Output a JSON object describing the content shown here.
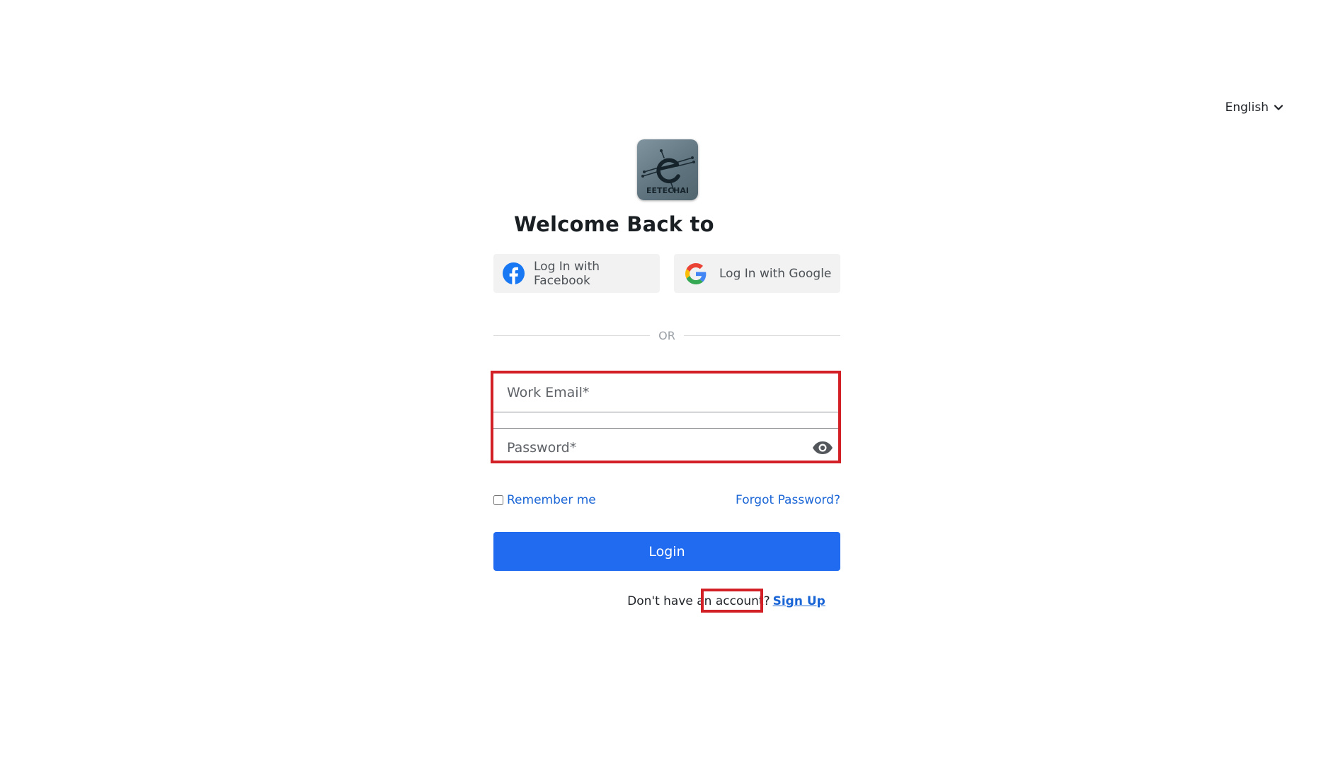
{
  "language": {
    "selected": "English",
    "icon": "chevron-down-icon"
  },
  "logo": {
    "text": "EETECHAI"
  },
  "heading": "Welcome Back to",
  "social": {
    "facebook_label": "Log In with Facebook",
    "google_label": "Log In with Google"
  },
  "divider": "OR",
  "form": {
    "email_placeholder": "Work Email*",
    "password_placeholder": "Password*",
    "remember_label": "Remember me",
    "forgot_label": "Forgot Password?",
    "login_label": "Login"
  },
  "signup": {
    "prompt": "Don't have an account?",
    "link": "Sign Up"
  },
  "colors": {
    "primary": "#206bf0",
    "link": "#1a65d6",
    "annotation": "#d32027",
    "social_bg": "#f2f2f2"
  }
}
